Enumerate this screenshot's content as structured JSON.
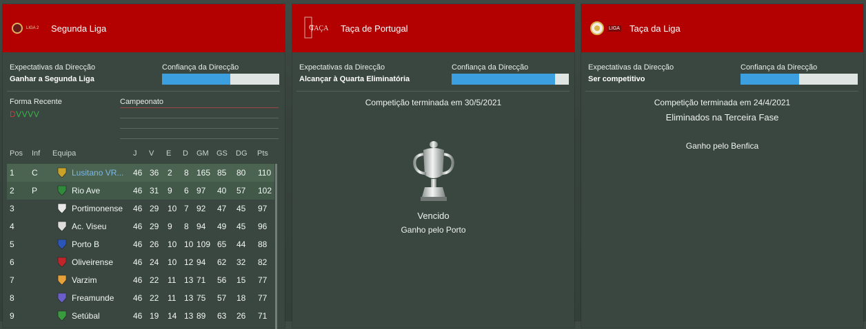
{
  "panels": [
    {
      "title": "Segunda Liga",
      "logo_text": "LIGA 2",
      "expect_label": "Expectativas da Direcção",
      "expect_value": "Ganhar a Segunda Liga",
      "conf_label": "Confiança da Direcção",
      "confidence": 0.58
    },
    {
      "title": "Taça de Portugal",
      "logo_text": "TAÇA",
      "expect_label": "Expectativas da Direcção",
      "expect_value": "Alcançar à Quarta Eliminatória",
      "conf_label": "Confiança da Direcção",
      "confidence": 0.88,
      "ended": "Competição terminada em 30/5/2021",
      "result": "Vencido",
      "winner": "Ganho pelo Porto"
    },
    {
      "title": "Taça da Liga",
      "logo_text": "LIGA",
      "expect_label": "Expectativas da Direcção",
      "expect_value": "Ser competitivo",
      "conf_label": "Confiança da Direcção",
      "confidence": 0.5,
      "ended": "Competição terminada em 24/4/2021",
      "result": "Eliminados na Terceira Fase",
      "winner": "Ganho pelo Benfica"
    }
  ],
  "form": {
    "label": "Forma Recente",
    "letters": [
      {
        "c": "D",
        "color": "#d03a3a"
      },
      {
        "c": "V",
        "color": "#3bb54a"
      },
      {
        "c": "V",
        "color": "#3bb54a"
      },
      {
        "c": "V",
        "color": "#3bb54a"
      },
      {
        "c": "V",
        "color": "#3bb54a"
      }
    ],
    "chart_label": "Campeonato"
  },
  "table": {
    "headers": [
      "Pos",
      "Inf",
      "Equipa",
      "J",
      "V",
      "E",
      "D",
      "GM",
      "GS",
      "DG",
      "Pts"
    ],
    "rows": [
      {
        "pos": "1",
        "inf": "C",
        "team": "Lusitano VR...",
        "j": "46",
        "v": "36",
        "e": "2",
        "d": "8",
        "gm": "165",
        "gs": "85",
        "dg": "80",
        "pts": "110",
        "crest": "#c9a227",
        "team_color": "#7db8e8"
      },
      {
        "pos": "2",
        "inf": "P",
        "team": "Rio Ave",
        "j": "46",
        "v": "31",
        "e": "9",
        "d": "6",
        "gm": "97",
        "gs": "40",
        "dg": "57",
        "pts": "102",
        "crest": "#2f8a3a",
        "team_color": "#f2f6f3"
      },
      {
        "pos": "3",
        "inf": "",
        "team": "Portimonense",
        "j": "46",
        "v": "29",
        "e": "10",
        "d": "7",
        "gm": "92",
        "gs": "47",
        "dg": "45",
        "pts": "97",
        "crest": "#e8e8e8",
        "team_color": "#f2f6f3"
      },
      {
        "pos": "4",
        "inf": "",
        "team": "Ac. Viseu",
        "j": "46",
        "v": "29",
        "e": "9",
        "d": "8",
        "gm": "94",
        "gs": "49",
        "dg": "45",
        "pts": "96",
        "crest": "#dddddd",
        "team_color": "#f2f6f3"
      },
      {
        "pos": "5",
        "inf": "",
        "team": "Porto B",
        "j": "46",
        "v": "26",
        "e": "10",
        "d": "10",
        "gm": "109",
        "gs": "65",
        "dg": "44",
        "pts": "88",
        "crest": "#2a56b8",
        "team_color": "#f2f6f3"
      },
      {
        "pos": "6",
        "inf": "",
        "team": "Oliveirense",
        "j": "46",
        "v": "24",
        "e": "10",
        "d": "12",
        "gm": "94",
        "gs": "62",
        "dg": "32",
        "pts": "82",
        "crest": "#c0252b",
        "team_color": "#f2f6f3"
      },
      {
        "pos": "7",
        "inf": "",
        "team": "Varzim",
        "j": "46",
        "v": "22",
        "e": "11",
        "d": "13",
        "gm": "71",
        "gs": "56",
        "dg": "15",
        "pts": "77",
        "crest": "#e5a03a",
        "team_color": "#f2f6f3"
      },
      {
        "pos": "8",
        "inf": "",
        "team": "Freamunde",
        "j": "46",
        "v": "22",
        "e": "11",
        "d": "13",
        "gm": "75",
        "gs": "57",
        "dg": "18",
        "pts": "77",
        "crest": "#6a5fc8",
        "team_color": "#f2f6f3"
      },
      {
        "pos": "9",
        "inf": "",
        "team": "Setúbal",
        "j": "46",
        "v": "19",
        "e": "14",
        "d": "13",
        "gm": "89",
        "gs": "63",
        "dg": "26",
        "pts": "71",
        "crest": "#3a9a3e",
        "team_color": "#f2f6f3"
      }
    ]
  },
  "colors": {
    "header": "#b30000",
    "confidence_bar": "#3b9fe0",
    "highlight_row": "#4b6451"
  }
}
